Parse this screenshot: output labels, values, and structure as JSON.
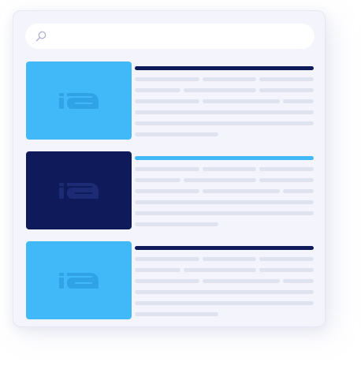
{
  "colors": {
    "window_bg": "#f3f4fc",
    "search_bg": "#ffffff",
    "text_line": "#dfe2ef",
    "accent_light": "#41b9f8",
    "accent_dark": "#0e1a5a",
    "logo_on_light": "#30a3e6",
    "logo_on_dark": "#1d2a74"
  },
  "search": {
    "placeholder": "",
    "icon": "search-icon"
  },
  "results": [
    {
      "thumbnail_color": "#41b9f8",
      "title_bar_color": "#0e1a5a",
      "logo_icon": "ia-logo-icon"
    },
    {
      "thumbnail_color": "#0e1a5a",
      "title_bar_color": "#41b9f8",
      "logo_icon": "ia-logo-icon"
    },
    {
      "thumbnail_color": "#41b9f8",
      "title_bar_color": "#0e1a5a",
      "logo_icon": "ia-logo-icon"
    }
  ]
}
